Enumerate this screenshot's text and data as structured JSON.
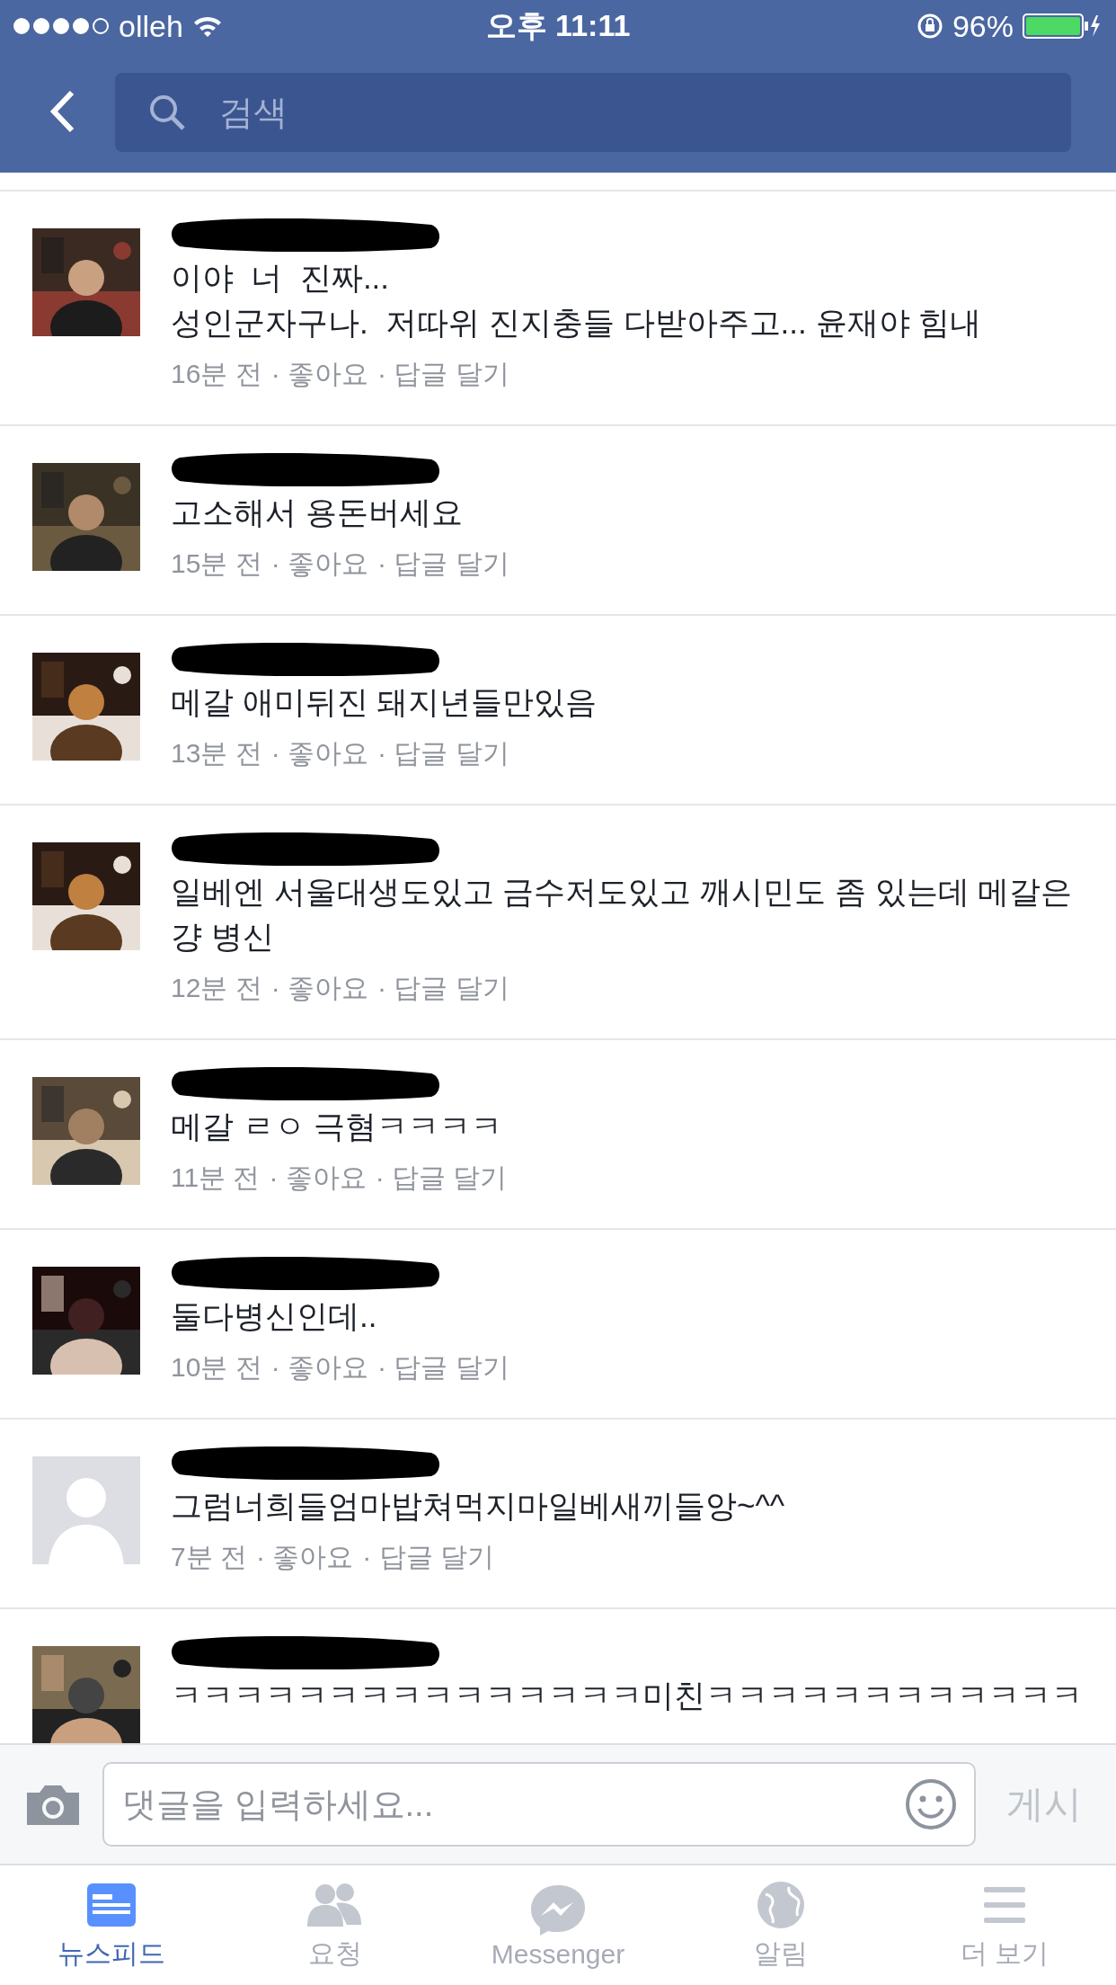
{
  "status_bar": {
    "carrier": "olleh",
    "time": "오후 11:11",
    "battery": "96%"
  },
  "nav": {
    "search": {
      "placeholder": "검색"
    }
  },
  "comments": [
    {
      "text": "이야  너  진짜...\n성인군자구나.  저따위 진지충들 다받아주고... 윤재야 힘내",
      "time": "16분 전",
      "like": "· 좋아요",
      "reply": "· 답글 달기"
    },
    {
      "text": "고소해서 용돈버세요",
      "time": "15분 전",
      "like": "· 좋아요",
      "reply": "· 답글 달기"
    },
    {
      "text": "메갈 애미뒤진 돼지년들만있음",
      "time": "13분 전",
      "like": "· 좋아요",
      "reply": "· 답글 달기"
    },
    {
      "text": "일베엔 서울대생도있고 금수저도있고 깨시민도 좀 있는데 메갈은 걍 병신",
      "time": "12분 전",
      "like": "· 좋아요",
      "reply": "· 답글 달기"
    },
    {
      "text": "메갈 ㄹㅇ 극혐ㅋㅋㅋㅋ",
      "time": "11분 전",
      "like": "· 좋아요",
      "reply": "· 답글 달기"
    },
    {
      "text": "둘다병신인데..",
      "time": "10분 전",
      "like": "· 좋아요",
      "reply": "· 답글 달기"
    },
    {
      "avatar": {
        "kind": "default"
      },
      "text": "그럼너희들엄마밥쳐먹지마일베새끼들앙~^^",
      "time": "7분 전",
      "like": "· 좋아요",
      "reply": "· 답글 달기"
    },
    {
      "text": "ㅋㅋㅋㅋㅋㅋㅋㅋㅋㅋㅋㅋㅋㅋㅋ미친ㅋㅋㅋㅋㅋㅋㅋㅋㅋㅋㅋㅋ"
    }
  ],
  "composer": {
    "placeholder": "댓글을 입력하세요...",
    "post": "게시",
    "post_disabled": true
  },
  "tabs": [
    {
      "label": "뉴스피드",
      "selected": true
    },
    {
      "label": "요청",
      "selected": false
    },
    {
      "label": "Messenger",
      "selected": false
    },
    {
      "label": "알림",
      "selected": false
    },
    {
      "label": "더 보기",
      "selected": false
    }
  ]
}
